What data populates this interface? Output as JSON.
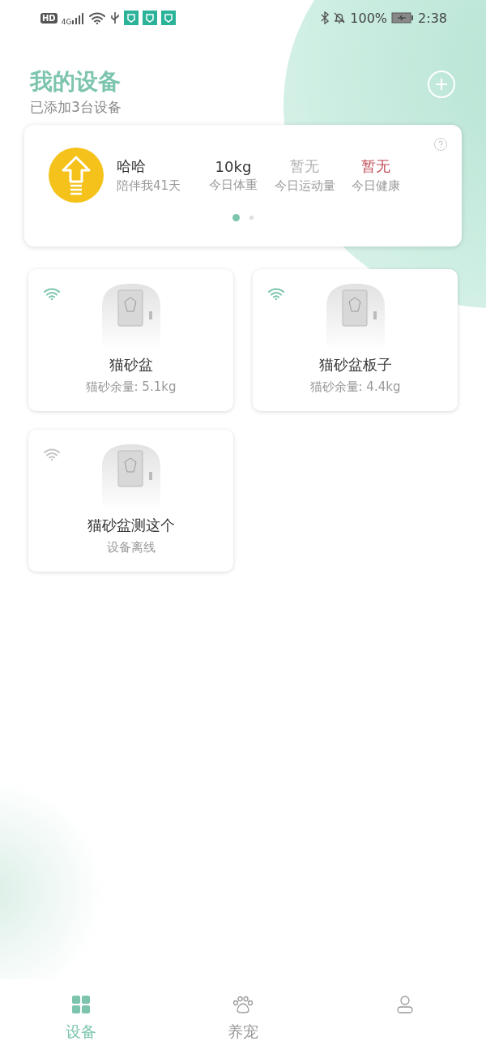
{
  "status_bar": {
    "hd": "HD",
    "network": "4G",
    "battery": "100%",
    "time": "2:38"
  },
  "header": {
    "title": "我的设备",
    "subtitle": "已添加3台设备"
  },
  "pet_summary": {
    "name": "哈哈",
    "days": "陪伴我41天",
    "stats": [
      {
        "value": "10kg",
        "label": "今日体重",
        "color": "#333333"
      },
      {
        "value": "暂无",
        "label": "今日运动量",
        "color": "#b0b0b0"
      },
      {
        "value": "暂无",
        "label": "今日健康",
        "color": "#c0505a"
      }
    ],
    "pages": [
      {
        "selected": true
      },
      {
        "selected": false
      }
    ]
  },
  "devices": [
    {
      "name": "猫砂盆",
      "status": "猫砂余量: 5.1kg",
      "online": true
    },
    {
      "name": "猫砂盆板子",
      "status": "猫砂余量: 4.4kg",
      "online": true
    },
    {
      "name": "猫砂盆测这个",
      "status": "设备离线",
      "online": false
    }
  ],
  "tabs": [
    {
      "kind": "devices",
      "label": "设备",
      "selected": true
    },
    {
      "kind": "pets",
      "label": "养宠",
      "selected": false
    },
    {
      "kind": "profile",
      "selected": false
    }
  ]
}
